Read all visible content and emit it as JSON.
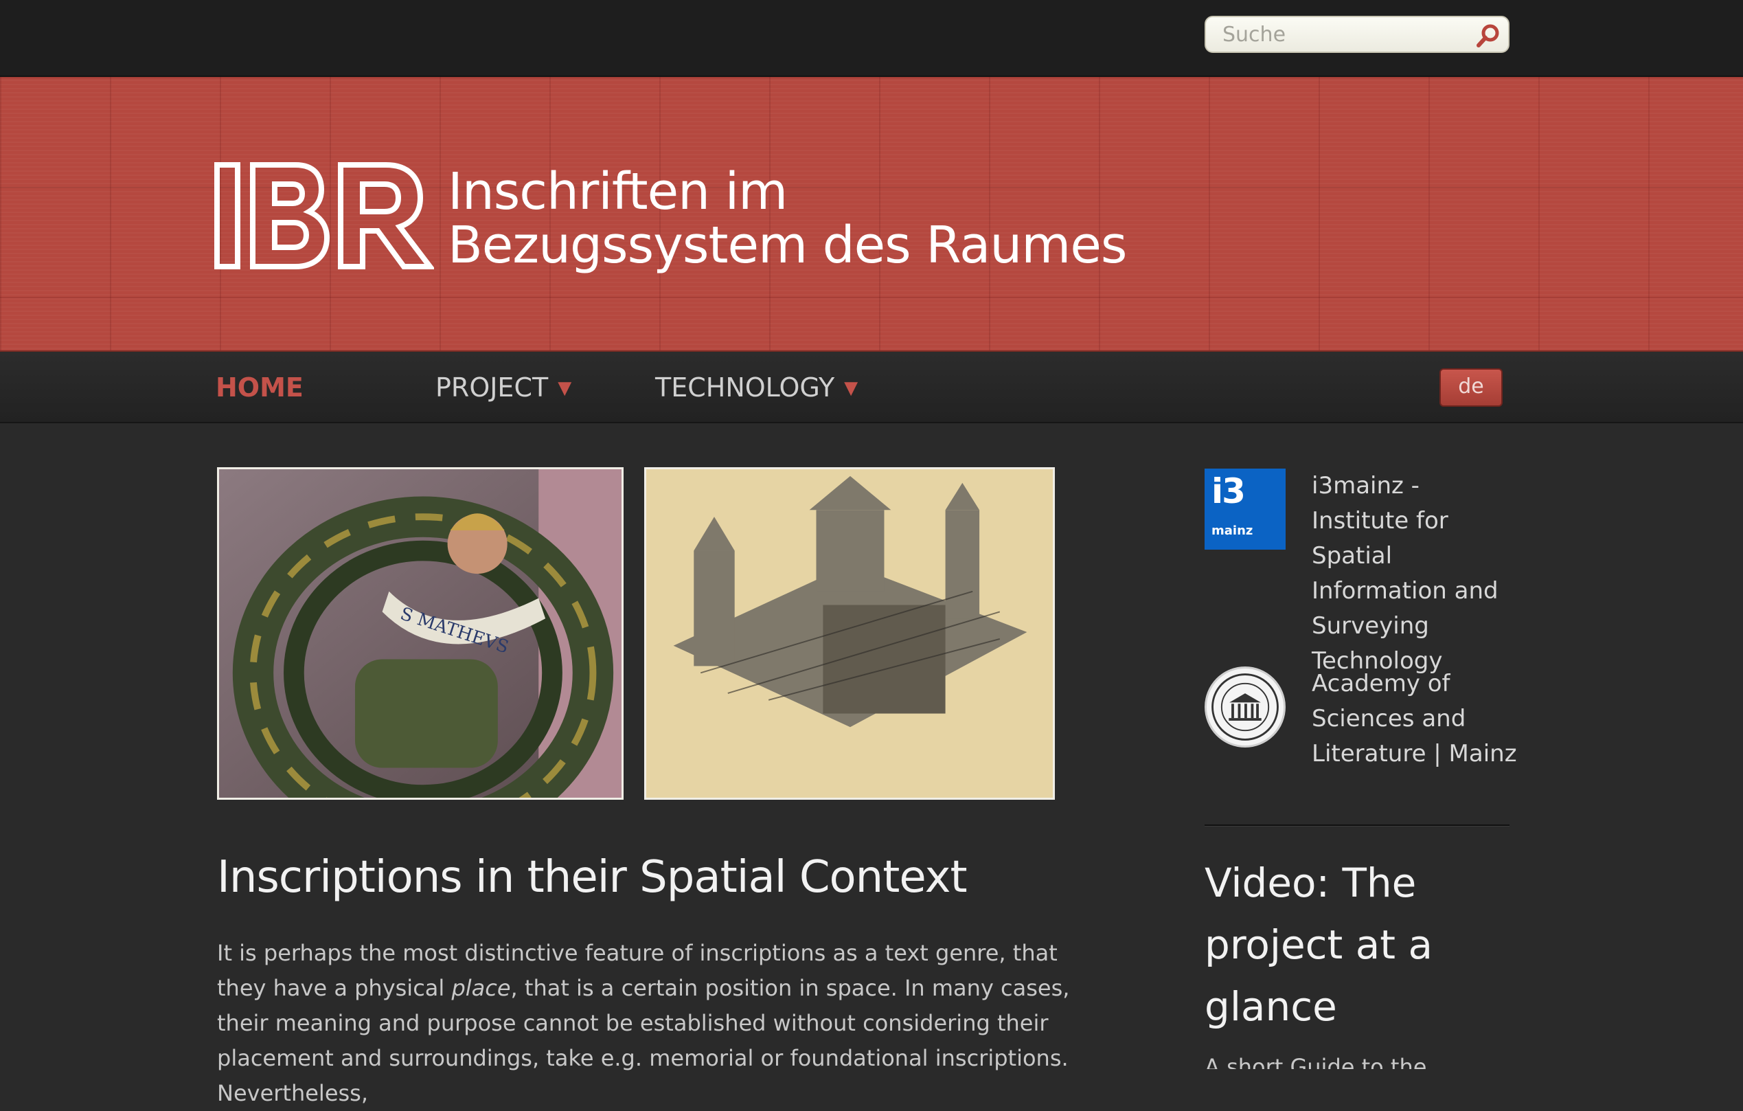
{
  "search": {
    "placeholder": "Suche",
    "icon": "search-icon"
  },
  "header": {
    "logo_text": "IBR",
    "title_line1": "Inschriften im",
    "title_line2": "Bezugssystem des Raumes"
  },
  "nav": {
    "items": [
      {
        "label": "HOME",
        "active": true
      },
      {
        "label": "PROJECT",
        "dropdown": true
      },
      {
        "label": "TECHNOLOGY",
        "dropdown": true
      }
    ],
    "dropdown_arrow": "▼",
    "language": "de"
  },
  "images": {
    "first_alt_text_shown": "S MATHEVS",
    "second": "3D model of church"
  },
  "main": {
    "headline": "Inscriptions in their Spatial Context",
    "intro_before_em": "It is perhaps the most distinctive feature of inscriptions as a text genre, that they have a physical ",
    "intro_em": "place",
    "intro_after_em": ", that is a certain position in space. In many cases, their meaning and purpose cannot be established without considering their placement and surroundings, take e.g. memorial or foundational inscriptions. Nevertheless,"
  },
  "sidebar": {
    "partners": [
      {
        "logo_big": "i3",
        "logo_small": "mainz",
        "name": "i3mainz - Institute for Spatial Information and Surveying Technology"
      },
      {
        "name": "Academy of Sciences and Literature | Mainz"
      }
    ],
    "video_title": "Video: The project at a glance",
    "video_sub": "A short Guide to the"
  },
  "colors": {
    "accent": "#c4524a",
    "banner": "#b5483f",
    "background": "#2a2a2a",
    "i3_blue": "#0b63c4"
  }
}
